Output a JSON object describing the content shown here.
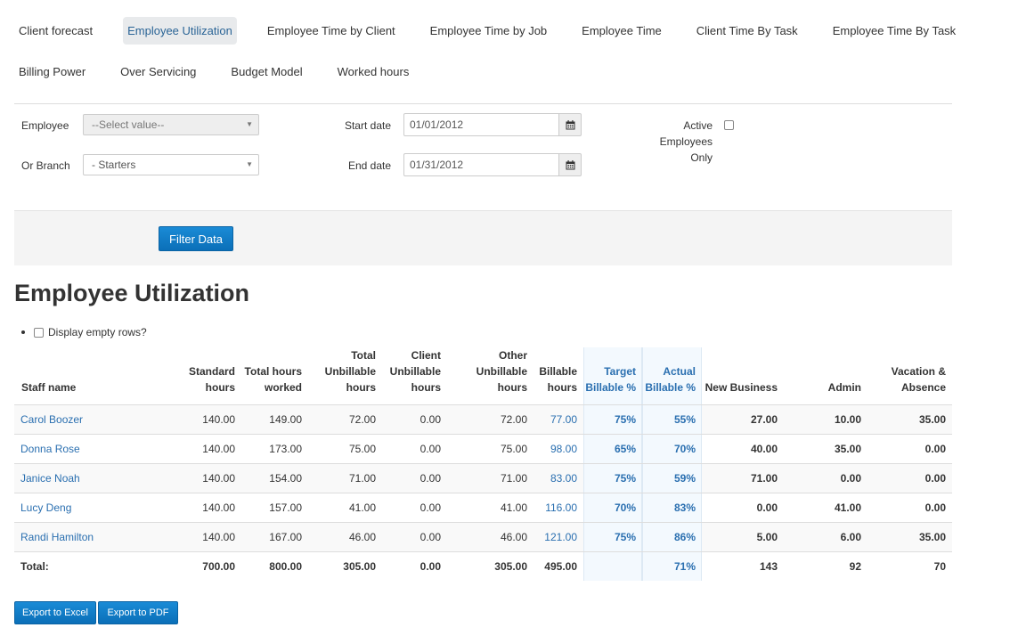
{
  "tabs": {
    "row1": [
      "Client forecast",
      "Employee Utilization",
      "Employee Time by Client",
      "Employee Time by Job",
      "Employee Time",
      "Client Time By Task",
      "Employee Time By Task"
    ],
    "row2": [
      "Billing Power",
      "Over Servicing",
      "Budget Model",
      "Worked hours"
    ],
    "active": "Employee Utilization"
  },
  "filters": {
    "employee_label": "Employee",
    "employee_value": "--Select value--",
    "branch_label": "Or Branch",
    "branch_value": "- Starters",
    "start_label": "Start date",
    "start_value": "01/01/2012",
    "end_label": "End date",
    "end_value": "01/31/2012",
    "active_label": "Active Employees Only",
    "filter_button": "Filter Data"
  },
  "report": {
    "title": "Employee Utilization",
    "empty_rows_label": "Display empty rows?"
  },
  "table": {
    "columns": [
      "Staff name",
      "Standard hours",
      "Total hours worked",
      "Total Unbillable hours",
      "Client Unbillable hours",
      "Other Unbillable hours",
      "Billable hours",
      "Target Billable %",
      "Actual Billable %",
      "New Business",
      "Admin",
      "Vacation & Absence"
    ],
    "rows": [
      [
        "Carol Boozer",
        "140.00",
        "149.00",
        "72.00",
        "0.00",
        "72.00",
        "77.00",
        "75%",
        "55%",
        "27.00",
        "10.00",
        "35.00"
      ],
      [
        "Donna Rose",
        "140.00",
        "173.00",
        "75.00",
        "0.00",
        "75.00",
        "98.00",
        "65%",
        "70%",
        "40.00",
        "35.00",
        "0.00"
      ],
      [
        "Janice Noah",
        "140.00",
        "154.00",
        "71.00",
        "0.00",
        "71.00",
        "83.00",
        "75%",
        "59%",
        "71.00",
        "0.00",
        "0.00"
      ],
      [
        "Lucy Deng",
        "140.00",
        "157.00",
        "41.00",
        "0.00",
        "41.00",
        "116.00",
        "70%",
        "83%",
        "0.00",
        "41.00",
        "0.00"
      ],
      [
        "Randi Hamilton",
        "140.00",
        "167.00",
        "46.00",
        "0.00",
        "46.00",
        "121.00",
        "75%",
        "86%",
        "5.00",
        "6.00",
        "35.00"
      ]
    ],
    "total": [
      "Total:",
      "700.00",
      "800.00",
      "305.00",
      "0.00",
      "305.00",
      "495.00",
      "",
      "71%",
      "143",
      "92",
      "70"
    ]
  },
  "export": {
    "excel": "Export to Excel",
    "pdf": "Export to PDF"
  },
  "colors": {
    "link": "#2a6fb0",
    "primary": "#0b6fb8",
    "active_tab_bg": "#e8eaec"
  }
}
